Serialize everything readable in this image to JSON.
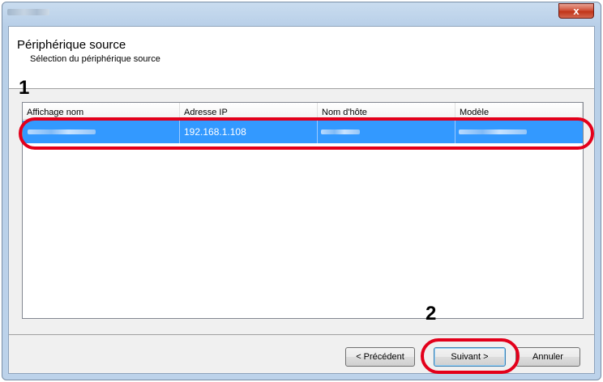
{
  "window": {
    "close_glyph": "x"
  },
  "header": {
    "title": "Périphérique source",
    "subtitle": "Sélection du périphérique source"
  },
  "annotations": {
    "marker_1": "1",
    "marker_2": "2",
    "highlight_color": "#e3001b"
  },
  "device_list": {
    "columns": [
      "Affichage nom",
      "Adresse IP",
      "Nom d'hôte",
      "Modèle"
    ],
    "rows": [
      {
        "display_name": "",
        "ip": "192.168.1.108",
        "hostname": "",
        "model": "",
        "selected": true
      }
    ],
    "selection_color": "#3399ff"
  },
  "footer": {
    "previous_label": "< Précédent",
    "next_label": "Suivant >",
    "cancel_label": "Annuler"
  }
}
